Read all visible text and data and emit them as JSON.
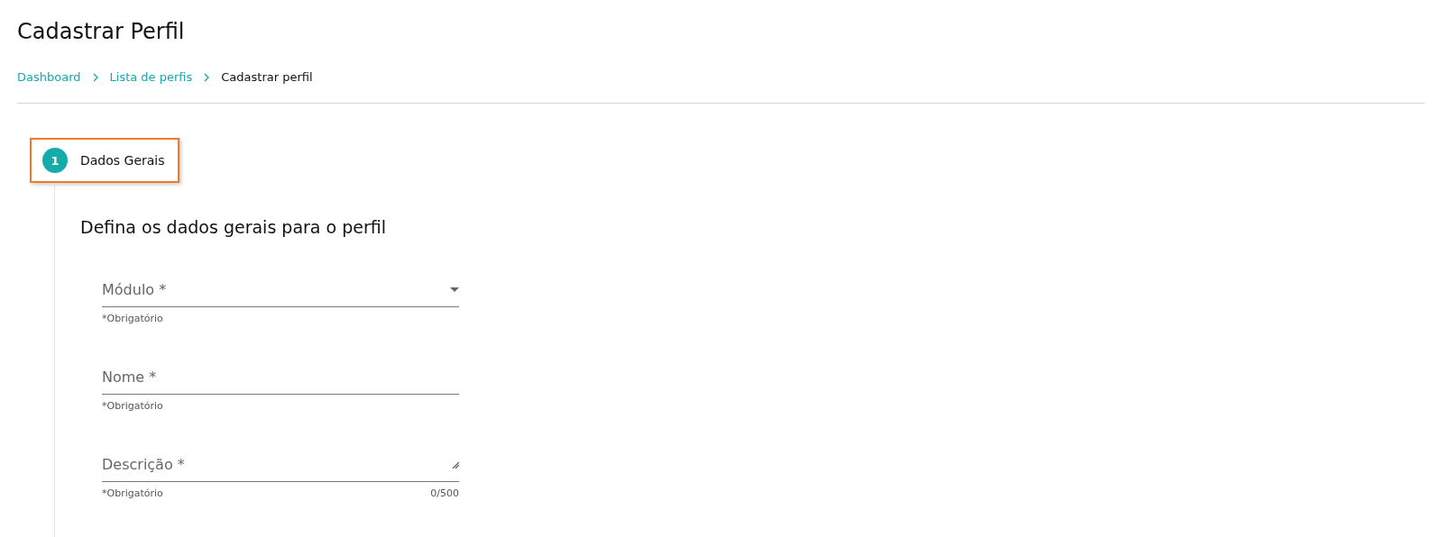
{
  "page_title": "Cadastrar Perfil",
  "breadcrumb": [
    {
      "label": "Dashboard",
      "kind": "link"
    },
    {
      "label": "Lista de perfis",
      "kind": "link"
    },
    {
      "label": "Cadastrar perfil",
      "kind": "current"
    }
  ],
  "stepper": {
    "steps": [
      {
        "number": "1",
        "label": "Dados Gerais",
        "selected": true
      }
    ]
  },
  "form": {
    "heading": "Defina os dados gerais para o perfil",
    "fields": [
      {
        "kind": "select",
        "label": "Módulo *",
        "hint": "*Obrigatório"
      },
      {
        "kind": "text",
        "label": "Nome *",
        "hint": "*Obrigatório"
      },
      {
        "kind": "textarea",
        "label": "Descrição *",
        "hint": "*Obrigatório",
        "counter": "0/500"
      }
    ]
  }
}
